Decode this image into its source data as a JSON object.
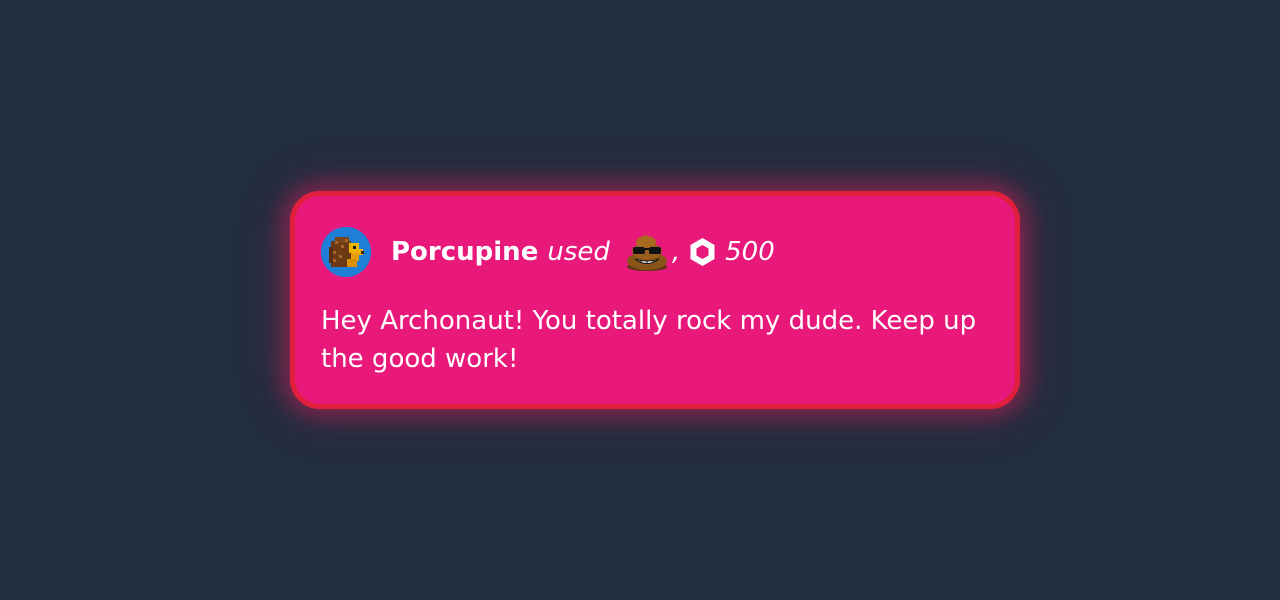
{
  "notification": {
    "username": "Porcupine",
    "action": "used",
    "separator": ",",
    "amount": "500",
    "message": "Hey Archonaut! You totally rock my dude. Keep up the good work!",
    "avatar_icon": "porcupine-avatar-icon",
    "item_icon": "poop-with-sunglasses-icon",
    "currency_icon": "hexagon-coin-icon"
  },
  "colors": {
    "background": "#222d3f",
    "card_fill": "#e8197a",
    "card_border": "#df1f3c",
    "avatar_bg": "#1f7ed6",
    "text": "#ffffff"
  }
}
